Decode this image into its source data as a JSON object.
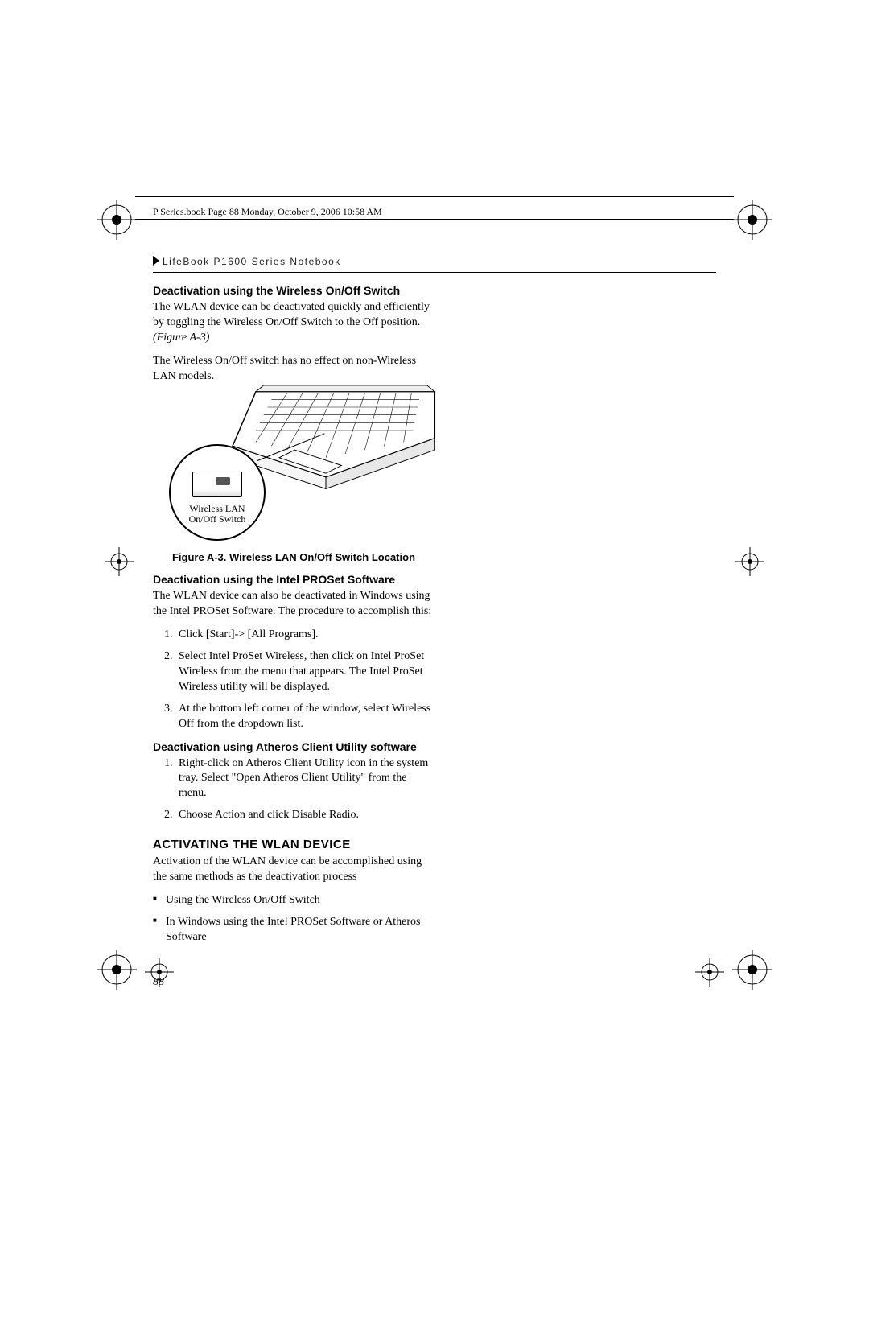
{
  "page_header": "P Series.book  Page 88  Monday, October 9, 2006  10:58 AM",
  "running_head": "LifeBook P1600 Series Notebook",
  "page_number": "88",
  "section1": {
    "heading": "Deactivation using the Wireless On/Off Switch",
    "p1_a": "The WLAN device can be deactivated quickly and efficiently by toggling the Wireless On/Off Switch to the Off position. ",
    "p1_ref": "(Figure A-3)",
    "p2": "The Wireless On/Off switch has no effect on non-Wireless LAN models."
  },
  "figure": {
    "callout_l1": "Wireless LAN",
    "callout_l2": "On/Off Switch",
    "caption": "Figure A-3. Wireless LAN On/Off Switch Location"
  },
  "section2": {
    "heading": "Deactivation using the Intel PROSet Software",
    "p1": "The WLAN device can also be deactivated in Windows using the Intel PROSet Software. The procedure to accomplish this:",
    "steps": [
      "Click [Start]-> [All Programs].",
      "Select Intel ProSet Wireless, then click on Intel ProSet Wireless from the menu that appears. The Intel ProSet Wireless utility will be displayed.",
      "At the bottom left corner of the window, select Wireless Off from the dropdown list."
    ]
  },
  "section3": {
    "heading": "Deactivation using Atheros Client Utility software",
    "steps": [
      "Right-click on Atheros Client Utility icon in the system tray. Select \"Open Atheros Client Utility\" from the menu.",
      "Choose Action and click Disable Radio."
    ]
  },
  "section4": {
    "heading": "ACTIVATING THE WLAN DEVICE",
    "p1": "Activation of the WLAN device can be accomplished using the same methods as the deactivation process",
    "bullets": [
      "Using the Wireless On/Off Switch",
      "In Windows using the Intel PROSet Software or Atheros Software"
    ]
  }
}
